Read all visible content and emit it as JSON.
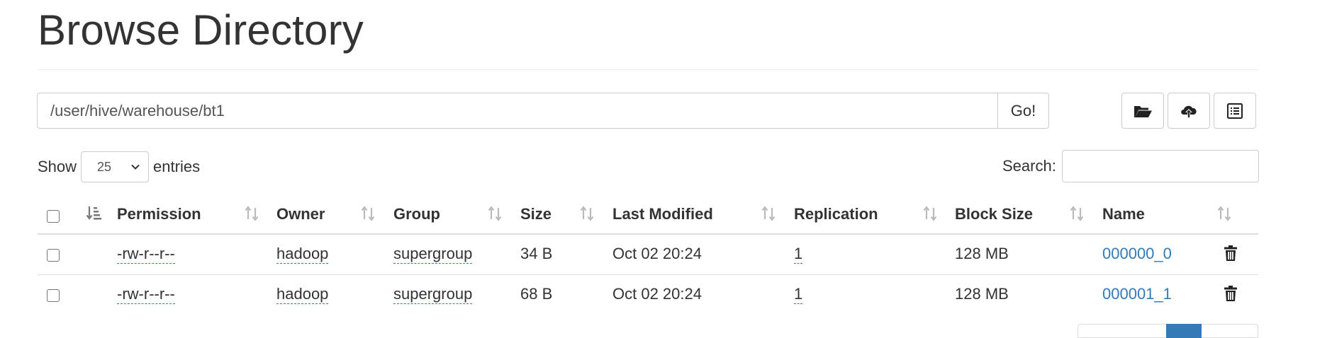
{
  "page": {
    "title": "Browse Directory"
  },
  "path_bar": {
    "value": "/user/hive/warehouse/bt1",
    "go_label": "Go!"
  },
  "toolbar": {
    "icons": [
      "folder-open-icon",
      "cloud-upload-icon",
      "list-alt-icon"
    ]
  },
  "length_control": {
    "show_label": "Show",
    "value": "25",
    "entries_label": "entries"
  },
  "search": {
    "label": "Search:",
    "value": ""
  },
  "table": {
    "columns": [
      "Permission",
      "Owner",
      "Group",
      "Size",
      "Last Modified",
      "Replication",
      "Block Size",
      "Name"
    ],
    "rows": [
      {
        "permission": "-rw-r--r--",
        "owner": "hadoop",
        "group": "supergroup",
        "size": "34 B",
        "modified": "Oct 02 20:24",
        "replication": "1",
        "block_size": "128 MB",
        "name": "000000_0"
      },
      {
        "permission": "-rw-r--r--",
        "owner": "hadoop",
        "group": "supergroup",
        "size": "68 B",
        "modified": "Oct 02 20:24",
        "replication": "1",
        "block_size": "128 MB",
        "name": "000001_1"
      }
    ]
  },
  "colors": {
    "link": "#337ab7",
    "border": "#dddddd",
    "text": "#333333"
  }
}
